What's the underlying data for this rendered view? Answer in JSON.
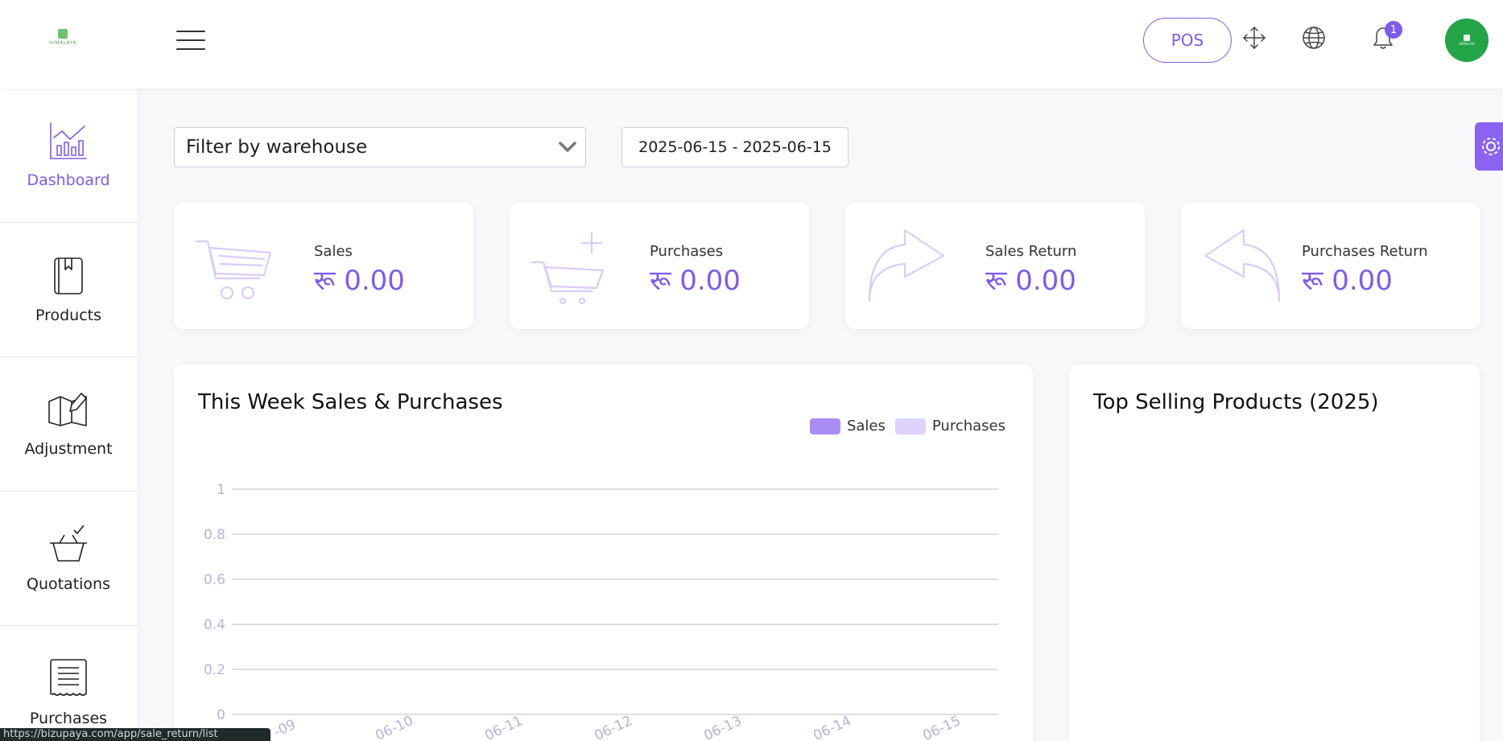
{
  "header": {
    "logo_text": "HIMALAYA",
    "pos_label": "POS",
    "notification_count": "1",
    "avatar_text": "HIMALAYA"
  },
  "sidebar": {
    "items": [
      {
        "label": "Dashboard",
        "icon": "chart-icon",
        "active": true
      },
      {
        "label": "Products",
        "icon": "book-icon"
      },
      {
        "label": "Adjustment",
        "icon": "map-edit-icon"
      },
      {
        "label": "Quotations",
        "icon": "basket-check-icon"
      },
      {
        "label": "Purchases",
        "icon": "receipt-icon"
      }
    ]
  },
  "filters": {
    "warehouse_placeholder": "Filter by warehouse",
    "date_range": "2025-06-15 - 2025-06-15"
  },
  "stats": [
    {
      "label": "Sales",
      "currency": "रू",
      "value": "0.00",
      "icon": "cart-icon"
    },
    {
      "label": "Purchases",
      "currency": "रू",
      "value": "0.00",
      "icon": "cart-plus-icon"
    },
    {
      "label": "Sales Return",
      "currency": "रू",
      "value": "0.00",
      "icon": "arrow-forward-icon"
    },
    {
      "label": "Purchases Return",
      "currency": "रू",
      "value": "0.00",
      "icon": "arrow-back-icon"
    }
  ],
  "colors": {
    "accent": "#7c5cf0",
    "sales": "#a98df5",
    "purchases": "#ddd3fb",
    "icon_light": "#d9ccf9"
  },
  "chart_data": {
    "type": "bar",
    "title": "This Week Sales & Purchases",
    "categories": [
      "2025-06-09",
      "2025-06-10",
      "2025-06-11",
      "2025-06-12",
      "2025-06-13",
      "2025-06-14",
      "2025-06-15"
    ],
    "tick_labels": [
      "-09",
      "06-10",
      "06-11",
      "06-12",
      "06-13",
      "06-14",
      "06-15"
    ],
    "series": [
      {
        "name": "Sales",
        "values": [
          0,
          0,
          0,
          0,
          0,
          0,
          0
        ]
      },
      {
        "name": "Purchases",
        "values": [
          0,
          0,
          0,
          0,
          0,
          0,
          0
        ]
      }
    ],
    "yticks": [
      "0",
      "0.2",
      "0.4",
      "0.6",
      "0.8",
      "1"
    ],
    "ylim": [
      0,
      1
    ],
    "grid": true,
    "legend": "top-right"
  },
  "top_selling": {
    "title": "Top Selling Products (2025)"
  },
  "status_bar": {
    "url": "https://bizupaya.com/app/sale_return/list"
  }
}
